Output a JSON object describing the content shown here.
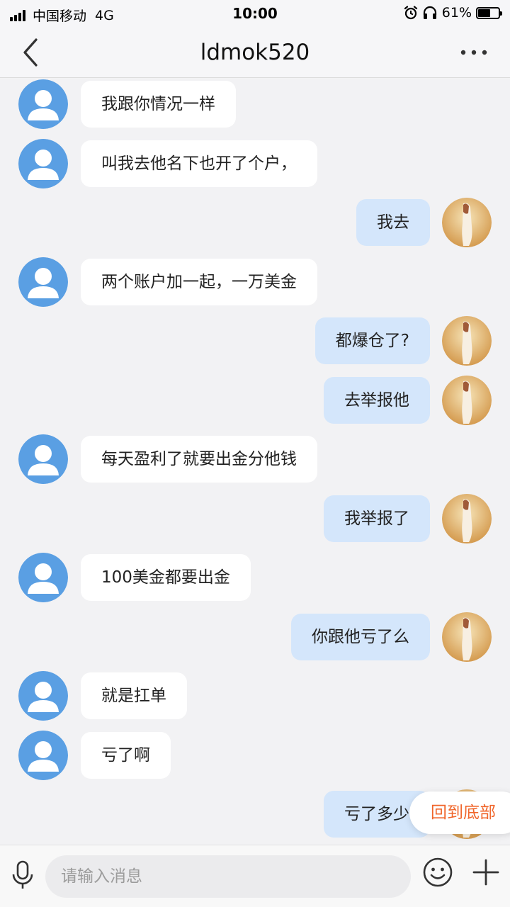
{
  "status_bar": {
    "carrier": "中国移动",
    "network": "4G",
    "time": "10:00",
    "battery_percent": "61%",
    "battery_level": 0.61,
    "icons": [
      "signal-icon",
      "alarm-icon",
      "headphones-icon",
      "battery-icon"
    ]
  },
  "header": {
    "title": "ldmok520",
    "icons": [
      "chevron-left-icon",
      "more-dots-icon"
    ]
  },
  "messages": [
    {
      "side": "left",
      "text": "我跟你情况一样"
    },
    {
      "side": "left",
      "text": "叫我去他名下也开了个户，"
    },
    {
      "side": "right",
      "text": "我去"
    },
    {
      "side": "left",
      "text": "两个账户加一起，一万美金"
    },
    {
      "side": "right",
      "text": "都爆仓了?"
    },
    {
      "side": "right",
      "text": "去举报他"
    },
    {
      "side": "left",
      "text": "每天盈利了就要出金分他钱"
    },
    {
      "side": "right",
      "text": "我举报了"
    },
    {
      "side": "left",
      "text": "100美金都要出金"
    },
    {
      "side": "right",
      "text": "你跟他亏了么"
    },
    {
      "side": "left",
      "text": "就是扛单"
    },
    {
      "side": "left",
      "text": "亏了啊"
    },
    {
      "side": "right",
      "text": "亏了多少"
    }
  ],
  "back_to_bottom_label": "回到底部",
  "input_bar": {
    "placeholder": "请输入消息",
    "icons": [
      "microphone-icon",
      "emoji-icon",
      "plus-icon"
    ]
  },
  "colors": {
    "accent": "#f0652a",
    "sent_bubble": "#d4e6fb",
    "received_bubble": "#ffffff",
    "avatar_blue": "#5a9fe3",
    "background": "#f2f2f4"
  }
}
